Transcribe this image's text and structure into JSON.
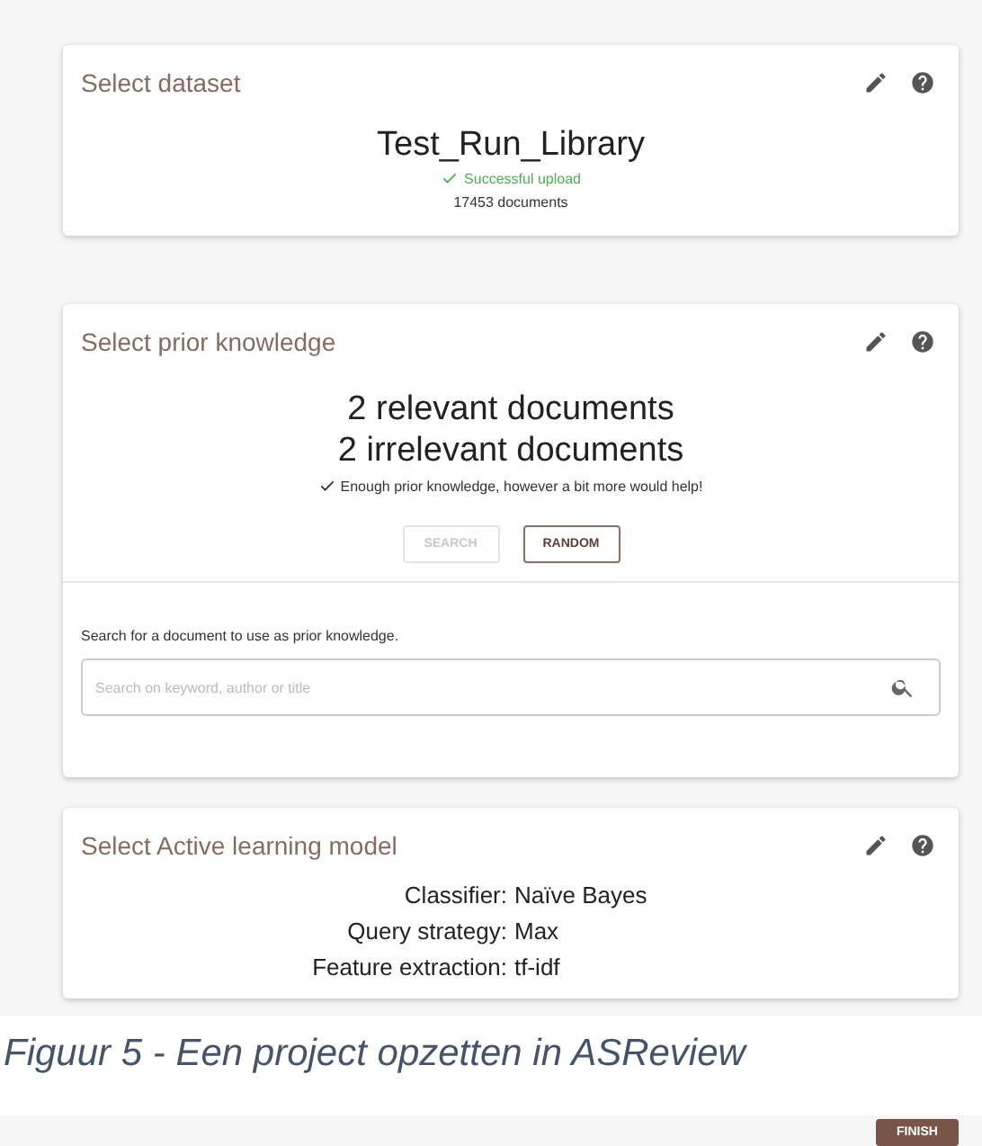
{
  "cards": [
    {
      "kind": "dataset",
      "title": "Select dataset",
      "dataset_name": "Test_Run_Library",
      "status": "Successful upload",
      "count": "17453 documents"
    },
    {
      "kind": "prior",
      "title": "Select prior knowledge",
      "headlines": [
        "2 relevant documents",
        "2 irrelevant documents"
      ],
      "note": "Enough prior knowledge, however a bit more would help!",
      "buttons": [
        {
          "label": "SEARCH",
          "disabled": true
        },
        {
          "label": "RANDOM",
          "disabled": false
        }
      ],
      "search_prompt": "Search for a document to use as prior knowledge.",
      "search": {
        "placeholder": "Search on keyword, author or title"
      }
    },
    {
      "kind": "model",
      "title": "Select Active learning model",
      "settings": [
        {
          "label": "Classifier:",
          "value": "Naïve Bayes"
        },
        {
          "label": "Query strategy:",
          "value": "Max"
        },
        {
          "label": "Feature extraction:",
          "value": "tf-idf"
        }
      ]
    }
  ],
  "caption": "Figuur 5 - Een project opzetten in ASReview",
  "footer_button": "FINISH"
}
